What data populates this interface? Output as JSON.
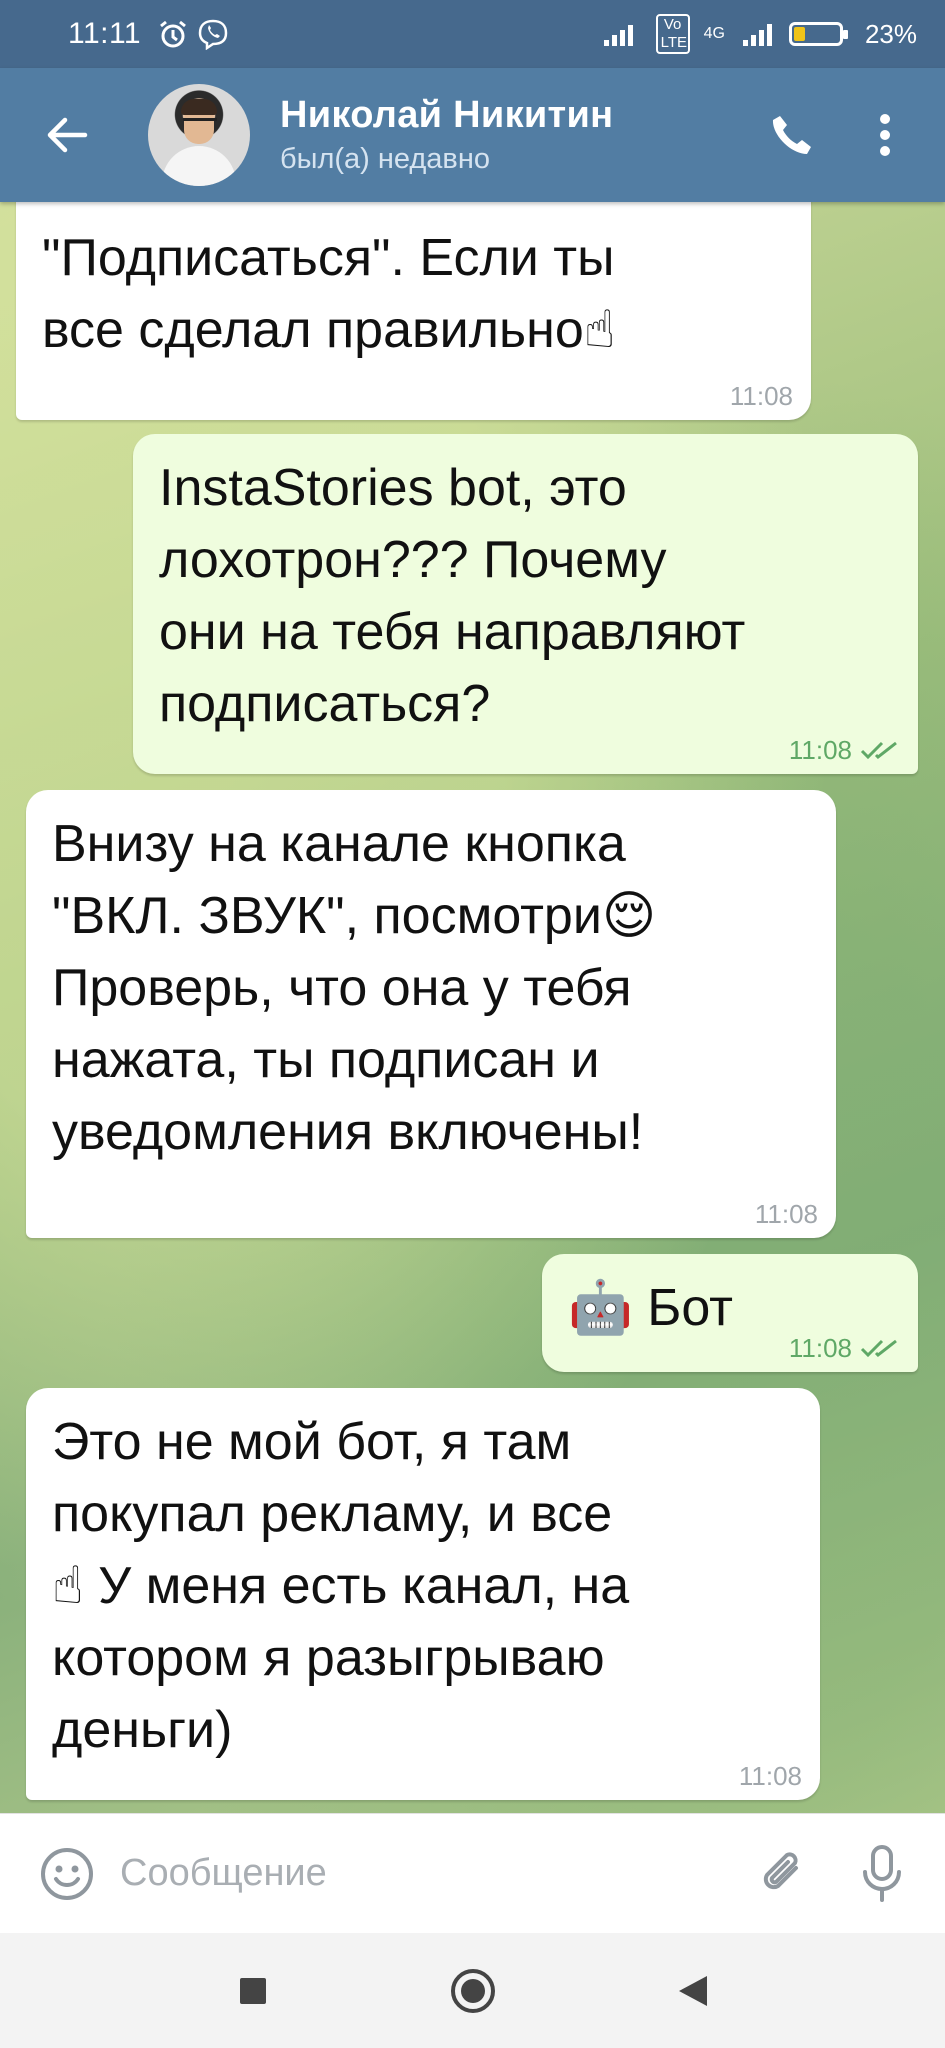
{
  "status_bar": {
    "time": "11:11",
    "battery_percent": "23%",
    "battery_level": 0.23,
    "signal_labels": [
      "Vo LTE",
      "4G"
    ],
    "icons": [
      "alarm-icon",
      "viber-icon",
      "signal-icon",
      "wifi-icon",
      "battery-icon"
    ]
  },
  "header": {
    "contact_name": "Николай Никитин",
    "contact_status": "был(а) недавно",
    "icons": [
      "back-arrow-icon",
      "phone-icon",
      "more-vert-icon"
    ]
  },
  "messages": [
    {
      "direction": "in",
      "text": "\"Подписаться\". Если ты\nвсе сделал правильно",
      "emoji": "☝",
      "time": "11:08"
    },
    {
      "direction": "out",
      "text": "InstaStories bot, это\nлохотрон??? Почему\nони на тебя направляют\nподписаться?",
      "time": "11:08",
      "read": true
    },
    {
      "direction": "in",
      "text_line1": "Внизу на канале кнопка",
      "text_line2": "\"ВКЛ. ЗВУК\", посмотри",
      "emoji": "😌",
      "text_rest": "Проверь, что она у тебя\nнажата, ты подписан и\nуведомления включены!",
      "time": "11:08"
    },
    {
      "direction": "out",
      "emoji": "🤖",
      "text": "Бот",
      "time": "11:08",
      "read": true
    },
    {
      "direction": "in",
      "text_line1": "Это не мой бот, я там\nпокупал рекламу, и все",
      "emoji": "☝",
      "text_line2": " У меня есть канал, на",
      "text_rest": "котором я разыгрываю\nденьги)",
      "time": "11:08"
    }
  ],
  "input": {
    "placeholder": "Сообщение",
    "value": ""
  },
  "nav": {
    "icons": [
      "recents-square-icon",
      "home-circle-icon",
      "back-triangle-icon"
    ]
  },
  "colors": {
    "status_bar": "#46698d",
    "header": "#527da3",
    "incoming_bubble": "#ffffff",
    "outgoing_bubble": "#effdde",
    "read_check": "#5fa866"
  }
}
